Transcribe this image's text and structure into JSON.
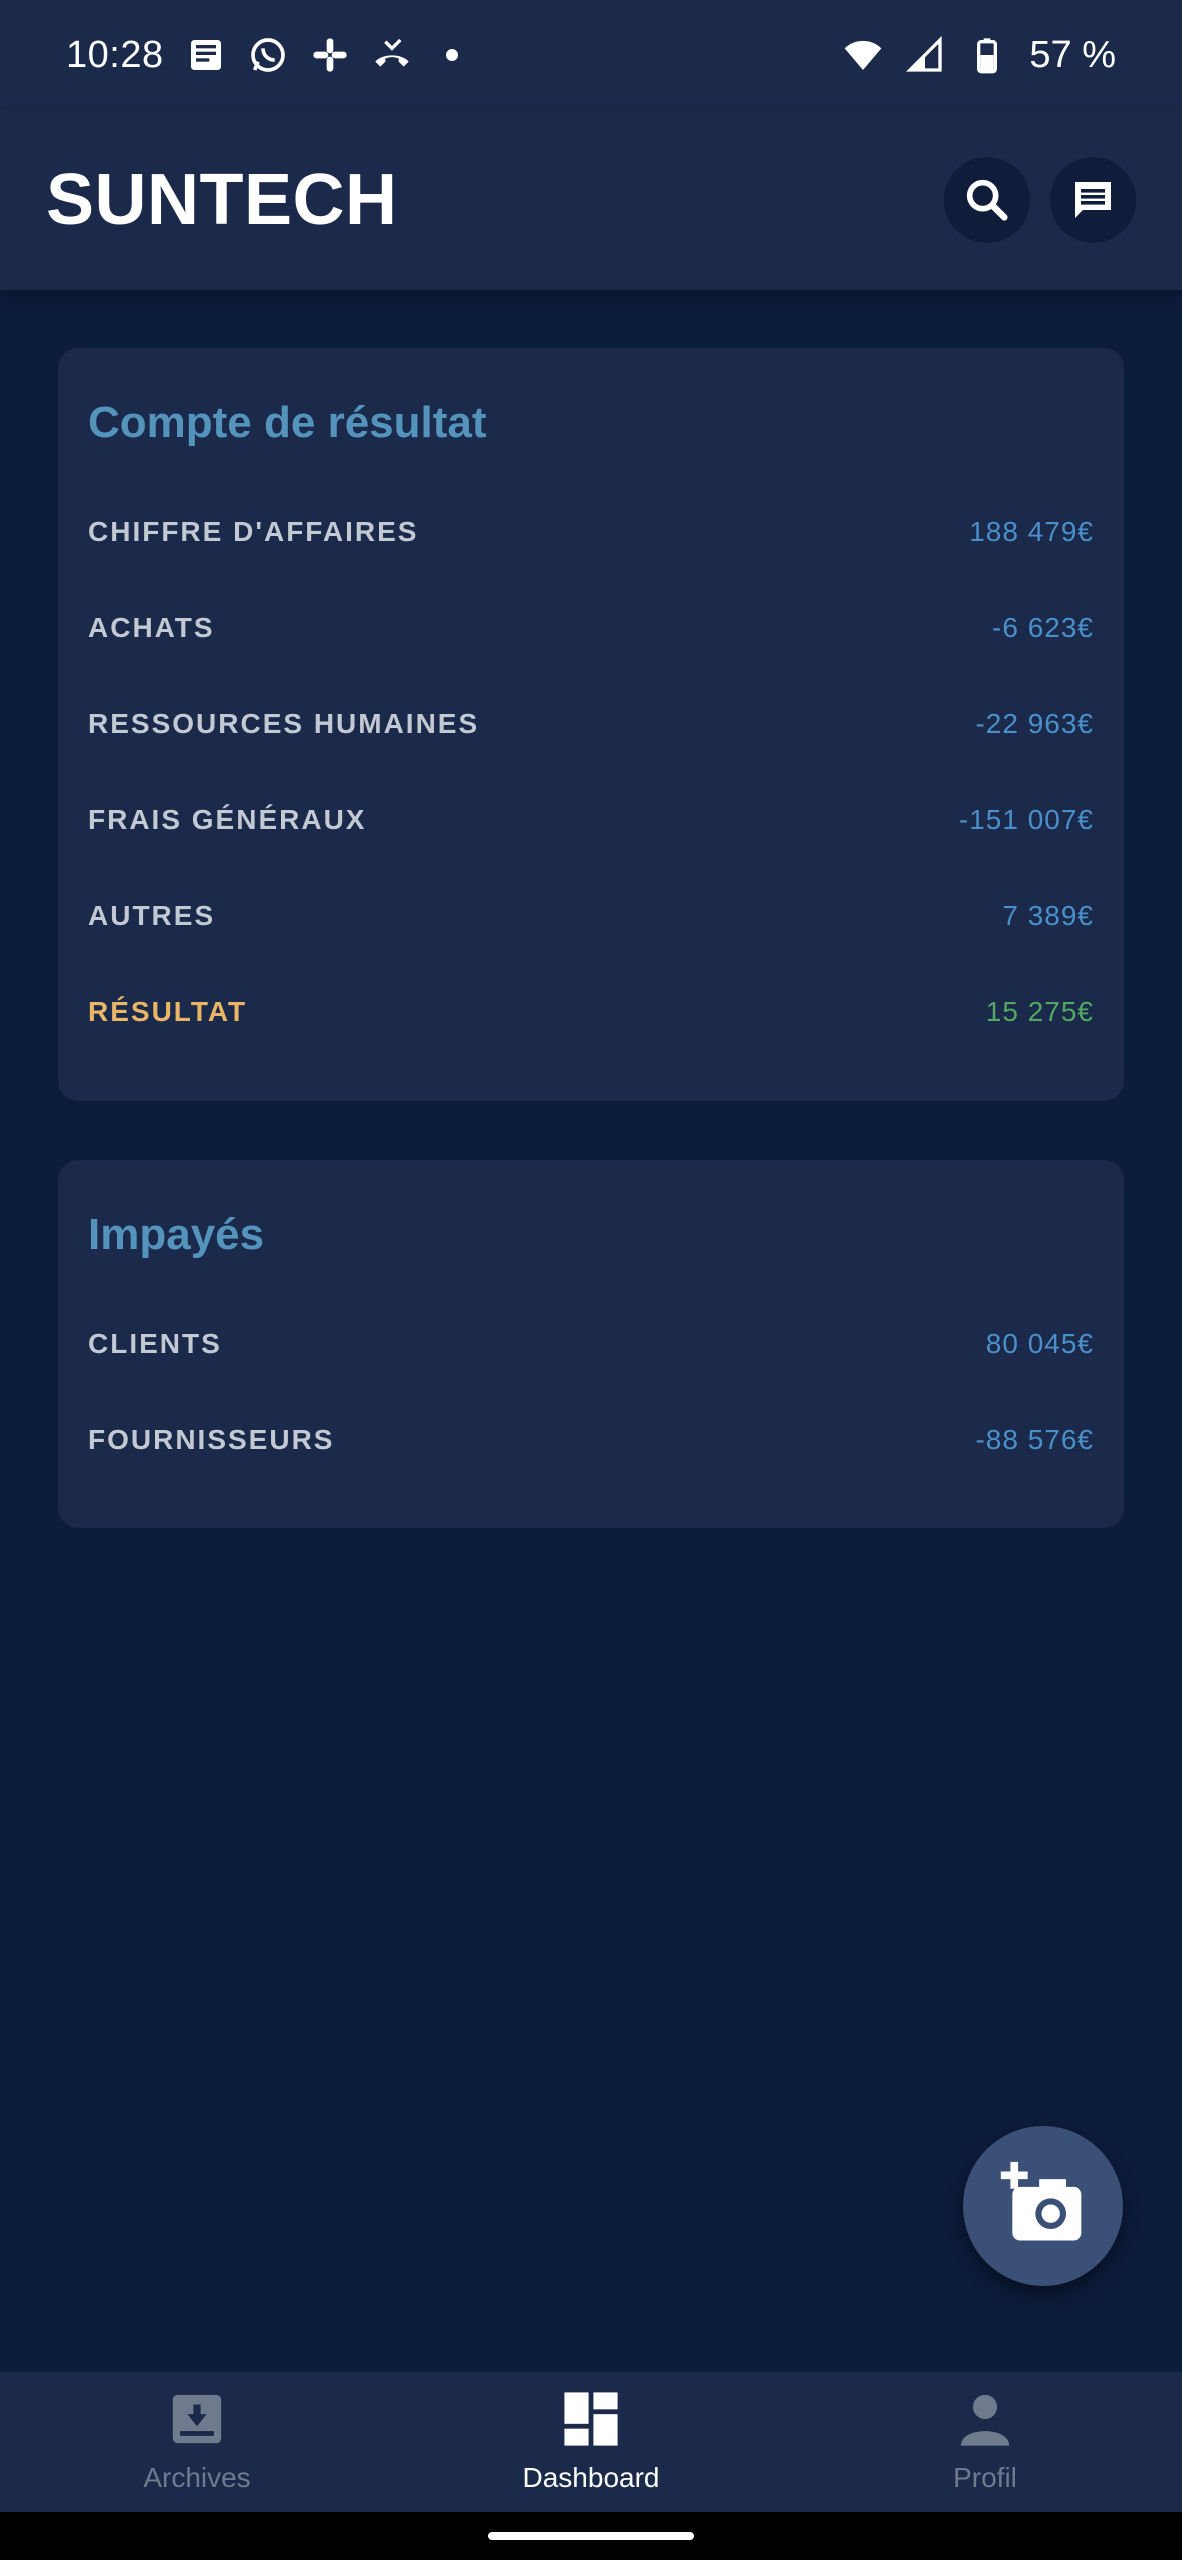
{
  "status_bar": {
    "time": "10:28",
    "battery_percent": "57 %",
    "notification_icons": [
      "news-icon",
      "whatsapp-icon",
      "slack-icon",
      "missed-call-icon",
      "dot-icon"
    ],
    "system_icons": [
      "wifi-icon",
      "signal-icon",
      "battery-icon"
    ]
  },
  "app_bar": {
    "title": "SUNTECH",
    "actions": [
      "search-icon",
      "message-icon"
    ]
  },
  "income_statement": {
    "title": "Compte de résultat",
    "rows": [
      {
        "label": "CHIFFRE D'AFFAIRES",
        "value": "188 479€"
      },
      {
        "label": "ACHATS",
        "value": "-6 623€"
      },
      {
        "label": "RESSOURCES HUMAINES",
        "value": "-22 963€"
      },
      {
        "label": "FRAIS GÉNÉRAUX",
        "value": "-151 007€"
      },
      {
        "label": "AUTRES",
        "value": "7 389€"
      },
      {
        "label": "RÉSULTAT",
        "value": "15 275€"
      }
    ]
  },
  "unpaid": {
    "title": "Impayés",
    "rows": [
      {
        "label": "CLIENTS",
        "value": "80 045€"
      },
      {
        "label": "FOURNISSEURS",
        "value": "-88 576€"
      }
    ]
  },
  "fab": {
    "icon": "add-photo-icon"
  },
  "bottom_nav": {
    "items": [
      {
        "label": "Archives",
        "icon": "archive-icon",
        "active": false
      },
      {
        "label": "Dashboard",
        "icon": "dashboard-icon",
        "active": true
      },
      {
        "label": "Profil",
        "icon": "person-icon",
        "active": false
      }
    ]
  },
  "colors": {
    "background": "#0c1c3b",
    "surface": "#1b2a4a",
    "card_title": "#5493bb",
    "value_blue": "#4a8fc9",
    "result_label": "#e9b666",
    "result_value": "#52a862"
  }
}
